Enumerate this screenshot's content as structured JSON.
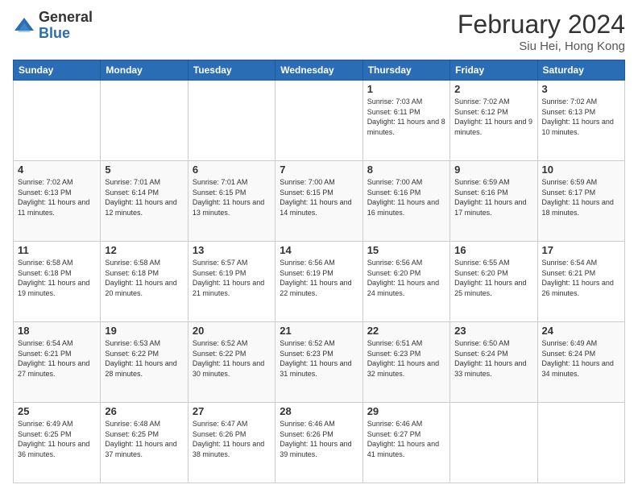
{
  "header": {
    "logo_general": "General",
    "logo_blue": "Blue",
    "month_year": "February 2024",
    "location": "Siu Hei, Hong Kong"
  },
  "days_of_week": [
    "Sunday",
    "Monday",
    "Tuesday",
    "Wednesday",
    "Thursday",
    "Friday",
    "Saturday"
  ],
  "weeks": [
    [
      {
        "day": "",
        "info": ""
      },
      {
        "day": "",
        "info": ""
      },
      {
        "day": "",
        "info": ""
      },
      {
        "day": "",
        "info": ""
      },
      {
        "day": "1",
        "info": "Sunrise: 7:03 AM\nSunset: 6:11 PM\nDaylight: 11 hours\nand 8 minutes."
      },
      {
        "day": "2",
        "info": "Sunrise: 7:02 AM\nSunset: 6:12 PM\nDaylight: 11 hours\nand 9 minutes."
      },
      {
        "day": "3",
        "info": "Sunrise: 7:02 AM\nSunset: 6:13 PM\nDaylight: 11 hours\nand 10 minutes."
      }
    ],
    [
      {
        "day": "4",
        "info": "Sunrise: 7:02 AM\nSunset: 6:13 PM\nDaylight: 11 hours\nand 11 minutes."
      },
      {
        "day": "5",
        "info": "Sunrise: 7:01 AM\nSunset: 6:14 PM\nDaylight: 11 hours\nand 12 minutes."
      },
      {
        "day": "6",
        "info": "Sunrise: 7:01 AM\nSunset: 6:15 PM\nDaylight: 11 hours\nand 13 minutes."
      },
      {
        "day": "7",
        "info": "Sunrise: 7:00 AM\nSunset: 6:15 PM\nDaylight: 11 hours\nand 14 minutes."
      },
      {
        "day": "8",
        "info": "Sunrise: 7:00 AM\nSunset: 6:16 PM\nDaylight: 11 hours\nand 16 minutes."
      },
      {
        "day": "9",
        "info": "Sunrise: 6:59 AM\nSunset: 6:16 PM\nDaylight: 11 hours\nand 17 minutes."
      },
      {
        "day": "10",
        "info": "Sunrise: 6:59 AM\nSunset: 6:17 PM\nDaylight: 11 hours\nand 18 minutes."
      }
    ],
    [
      {
        "day": "11",
        "info": "Sunrise: 6:58 AM\nSunset: 6:18 PM\nDaylight: 11 hours\nand 19 minutes."
      },
      {
        "day": "12",
        "info": "Sunrise: 6:58 AM\nSunset: 6:18 PM\nDaylight: 11 hours\nand 20 minutes."
      },
      {
        "day": "13",
        "info": "Sunrise: 6:57 AM\nSunset: 6:19 PM\nDaylight: 11 hours\nand 21 minutes."
      },
      {
        "day": "14",
        "info": "Sunrise: 6:56 AM\nSunset: 6:19 PM\nDaylight: 11 hours\nand 22 minutes."
      },
      {
        "day": "15",
        "info": "Sunrise: 6:56 AM\nSunset: 6:20 PM\nDaylight: 11 hours\nand 24 minutes."
      },
      {
        "day": "16",
        "info": "Sunrise: 6:55 AM\nSunset: 6:20 PM\nDaylight: 11 hours\nand 25 minutes."
      },
      {
        "day": "17",
        "info": "Sunrise: 6:54 AM\nSunset: 6:21 PM\nDaylight: 11 hours\nand 26 minutes."
      }
    ],
    [
      {
        "day": "18",
        "info": "Sunrise: 6:54 AM\nSunset: 6:21 PM\nDaylight: 11 hours\nand 27 minutes."
      },
      {
        "day": "19",
        "info": "Sunrise: 6:53 AM\nSunset: 6:22 PM\nDaylight: 11 hours\nand 28 minutes."
      },
      {
        "day": "20",
        "info": "Sunrise: 6:52 AM\nSunset: 6:22 PM\nDaylight: 11 hours\nand 30 minutes."
      },
      {
        "day": "21",
        "info": "Sunrise: 6:52 AM\nSunset: 6:23 PM\nDaylight: 11 hours\nand 31 minutes."
      },
      {
        "day": "22",
        "info": "Sunrise: 6:51 AM\nSunset: 6:23 PM\nDaylight: 11 hours\nand 32 minutes."
      },
      {
        "day": "23",
        "info": "Sunrise: 6:50 AM\nSunset: 6:24 PM\nDaylight: 11 hours\nand 33 minutes."
      },
      {
        "day": "24",
        "info": "Sunrise: 6:49 AM\nSunset: 6:24 PM\nDaylight: 11 hours\nand 34 minutes."
      }
    ],
    [
      {
        "day": "25",
        "info": "Sunrise: 6:49 AM\nSunset: 6:25 PM\nDaylight: 11 hours\nand 36 minutes."
      },
      {
        "day": "26",
        "info": "Sunrise: 6:48 AM\nSunset: 6:25 PM\nDaylight: 11 hours\nand 37 minutes."
      },
      {
        "day": "27",
        "info": "Sunrise: 6:47 AM\nSunset: 6:26 PM\nDaylight: 11 hours\nand 38 minutes."
      },
      {
        "day": "28",
        "info": "Sunrise: 6:46 AM\nSunset: 6:26 PM\nDaylight: 11 hours\nand 39 minutes."
      },
      {
        "day": "29",
        "info": "Sunrise: 6:46 AM\nSunset: 6:27 PM\nDaylight: 11 hours\nand 41 minutes."
      },
      {
        "day": "",
        "info": ""
      },
      {
        "day": "",
        "info": ""
      }
    ]
  ]
}
